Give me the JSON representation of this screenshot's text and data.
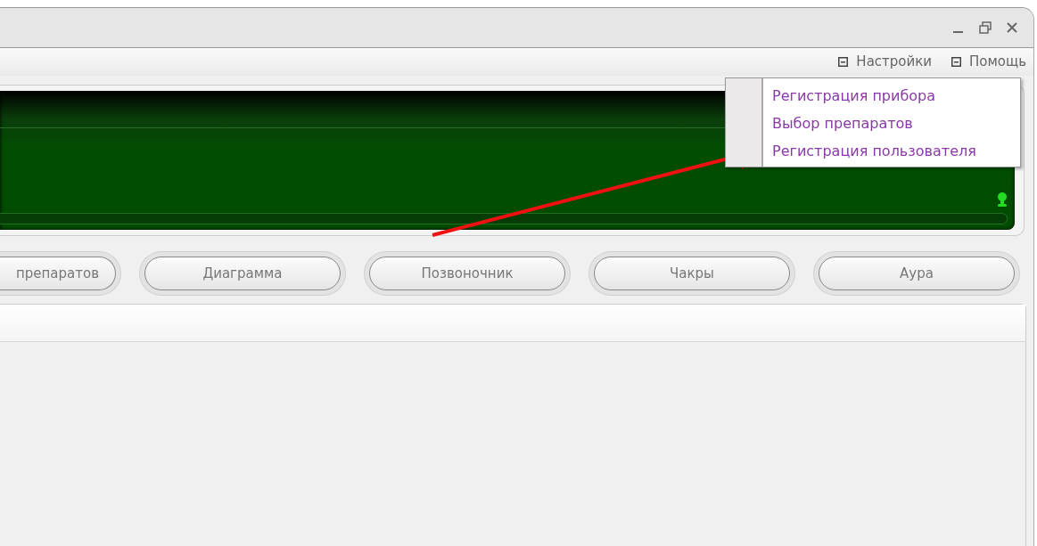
{
  "menu_bar": [
    {
      "label": "Настройки"
    },
    {
      "label": "Помощь"
    }
  ],
  "dropdown": [
    {
      "label": "Регистрация прибора"
    },
    {
      "label": "Выбор препаратов"
    },
    {
      "label": "Регистрация пользователя"
    }
  ],
  "buttons": [
    {
      "label": "препаратов"
    },
    {
      "label": "Диаграмма"
    },
    {
      "label": "Позвоночник"
    },
    {
      "label": "Чакры"
    },
    {
      "label": "Аура"
    }
  ]
}
